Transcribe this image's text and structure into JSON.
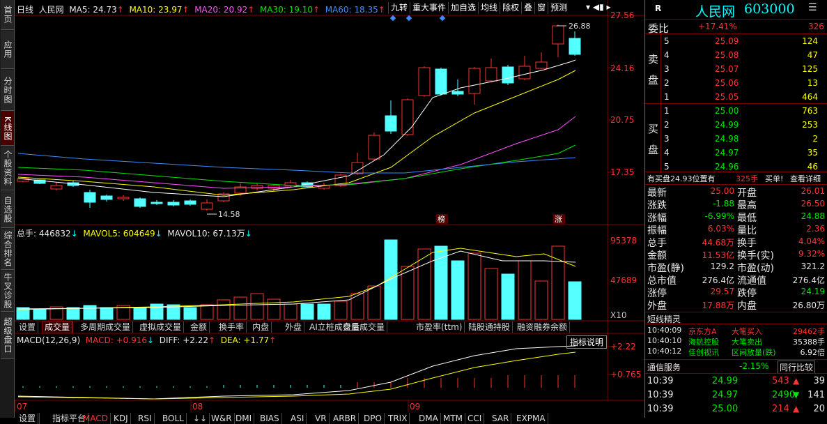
{
  "side_tabs": [
    "首页",
    "应用",
    "分时图",
    "K线图",
    "个股资料",
    "自选股",
    "综合排名",
    "牛叉诊股",
    "超级盘口"
  ],
  "header": {
    "period": "日线",
    "stock": "人民网",
    "ma5": "MA5: 24.73",
    "ma10": "MA10: 23.97",
    "ma20": "MA20: 20.92",
    "ma30": "MA30: 19.10",
    "ma60": "MA60: 18.35"
  },
  "toolbar": [
    "九转",
    "重大事件",
    "加自选",
    "均线",
    "除权",
    "叠",
    "窗",
    "预测"
  ],
  "price_axis": [
    "27.56",
    "24.16",
    "20.75",
    "17.35"
  ],
  "annotations": {
    "high": "26.88",
    "low": "14.58",
    "bang": "榜",
    "zhang": "涨"
  },
  "volume_header": {
    "total": "总手: 446832",
    "mavol5": "MAVOL5: 604649",
    "mavol10": "MAVOL10: 67.13万"
  },
  "volume_axis": [
    "95378",
    "47689",
    "X10"
  ],
  "func_tabs": [
    "设置",
    "成交量",
    "多周期成交量",
    "虚拟成交量",
    "金额",
    "换手率",
    "内盘",
    "外盘",
    "AI立桩成交量",
    "盘后成交量",
    "市盈率(ttm)",
    "陆股通持股",
    "融资融券余额"
  ],
  "macd_header": {
    "name": "MACD(12,26,9)",
    "macd": "MACD: +0.916",
    "diff": "DIFF: +2.22",
    "dea": "DEA: +1.77"
  },
  "macd_button": "指标说明",
  "macd_axis": [
    "+2.22",
    "+0.765"
  ],
  "date_labels": [
    "07",
    "08",
    "09"
  ],
  "bottom_tabs": [
    "设置",
    "",
    "指标平台",
    "MACD",
    "KDJ",
    "RSI",
    "BOLL",
    "↓↓",
    "W&R",
    "DMI",
    "BIAS",
    "ASI",
    "VR",
    "ARBR",
    "DPO",
    "TRIX",
    "DMA",
    "MTM",
    "CCI",
    "SAR",
    "EXPMA"
  ],
  "quote": {
    "logo": "R",
    "name": "人民网",
    "code": "603000",
    "webi_label": "委比",
    "webi_val": "+17.41%",
    "webi_diff": "326",
    "sell_label": "卖盘",
    "buy_label": "买盘",
    "sell": [
      {
        "n": "5",
        "p": "25.09",
        "v": "124"
      },
      {
        "n": "4",
        "p": "25.08",
        "v": "47"
      },
      {
        "n": "3",
        "p": "25.07",
        "v": "125"
      },
      {
        "n": "2",
        "p": "25.06",
        "v": "13"
      },
      {
        "n": "1",
        "p": "25.05",
        "v": "464"
      }
    ],
    "buy": [
      {
        "n": "1",
        "p": "25.00",
        "v": "763"
      },
      {
        "n": "2",
        "p": "24.99",
        "v": "253"
      },
      {
        "n": "3",
        "p": "24.98",
        "v": "2"
      },
      {
        "n": "4",
        "p": "24.97",
        "v": "35"
      },
      {
        "n": "5",
        "p": "24.96",
        "v": "46"
      }
    ],
    "buy_order_msg": "有买盘24.93位置有",
    "buy_order_qty": "325手",
    "buy_order_tag": "买单!",
    "detail_btn": "查看详细",
    "stats": [
      {
        "l1": "最新",
        "v1": "25.00",
        "l2": "开盘",
        "v2": "26.01"
      },
      {
        "l1": "涨跌",
        "v1": "-1.88",
        "l2": "最高",
        "v2": "26.50"
      },
      {
        "l1": "涨幅",
        "v1": "-6.99%",
        "l2": "最低",
        "v2": "24.88"
      },
      {
        "l1": "振幅",
        "v1": "6.03%",
        "l2": "量比",
        "v2": "2.36"
      },
      {
        "l1": "总手",
        "v1": "44.68万",
        "l2": "换手",
        "v2": "4.04%"
      },
      {
        "l1": "金额",
        "v1": "11.53亿",
        "l2": "换手(实)",
        "v2": "9.32%"
      },
      {
        "l1": "市盈(静)",
        "v1": "129.2",
        "l2": "市盈(动)",
        "v2": "321.2"
      },
      {
        "l1": "总市值",
        "v1": "276.4亿",
        "l2": "流通值",
        "v2": "276.4亿"
      },
      {
        "l1": "涨停",
        "v1": "29.57",
        "l2": "跌停",
        "v2": "24.19"
      },
      {
        "l1": "外盘",
        "v1": "17.88万",
        "l2": "内盘",
        "v2": "26.80万"
      }
    ],
    "jingling_title": "短线精灵",
    "jingling": [
      {
        "t": "10:40:09",
        "n": "京东方A",
        "e": "大笔买入",
        "v": "29462手"
      },
      {
        "t": "10:40:10",
        "n": "海航控股",
        "e": "大笔卖出",
        "v": "35388手"
      },
      {
        "t": "10:40:12",
        "n": "佳创视讯",
        "e": "区间放量(跌)",
        "v": "6.92倍"
      }
    ],
    "sector_name": "通信服务",
    "sector_pct": "-2.15%",
    "sector_btn": "同行比较",
    "ticks": [
      {
        "t": "10:39",
        "p": "24.99",
        "v": "543",
        "n": "39"
      },
      {
        "t": "10:39",
        "p": "24.97",
        "v": "2490",
        "n": "141"
      },
      {
        "t": "10:39",
        "p": "25.00",
        "v": "214",
        "n": "20"
      }
    ]
  },
  "colors": {
    "up": "#ff3232",
    "down": "#54ffff",
    "ma5": "#ffffff",
    "ma10": "#ffff00",
    "ma20": "#ff50ff",
    "ma30": "#00e600",
    "ma60": "#3c8cff"
  }
}
